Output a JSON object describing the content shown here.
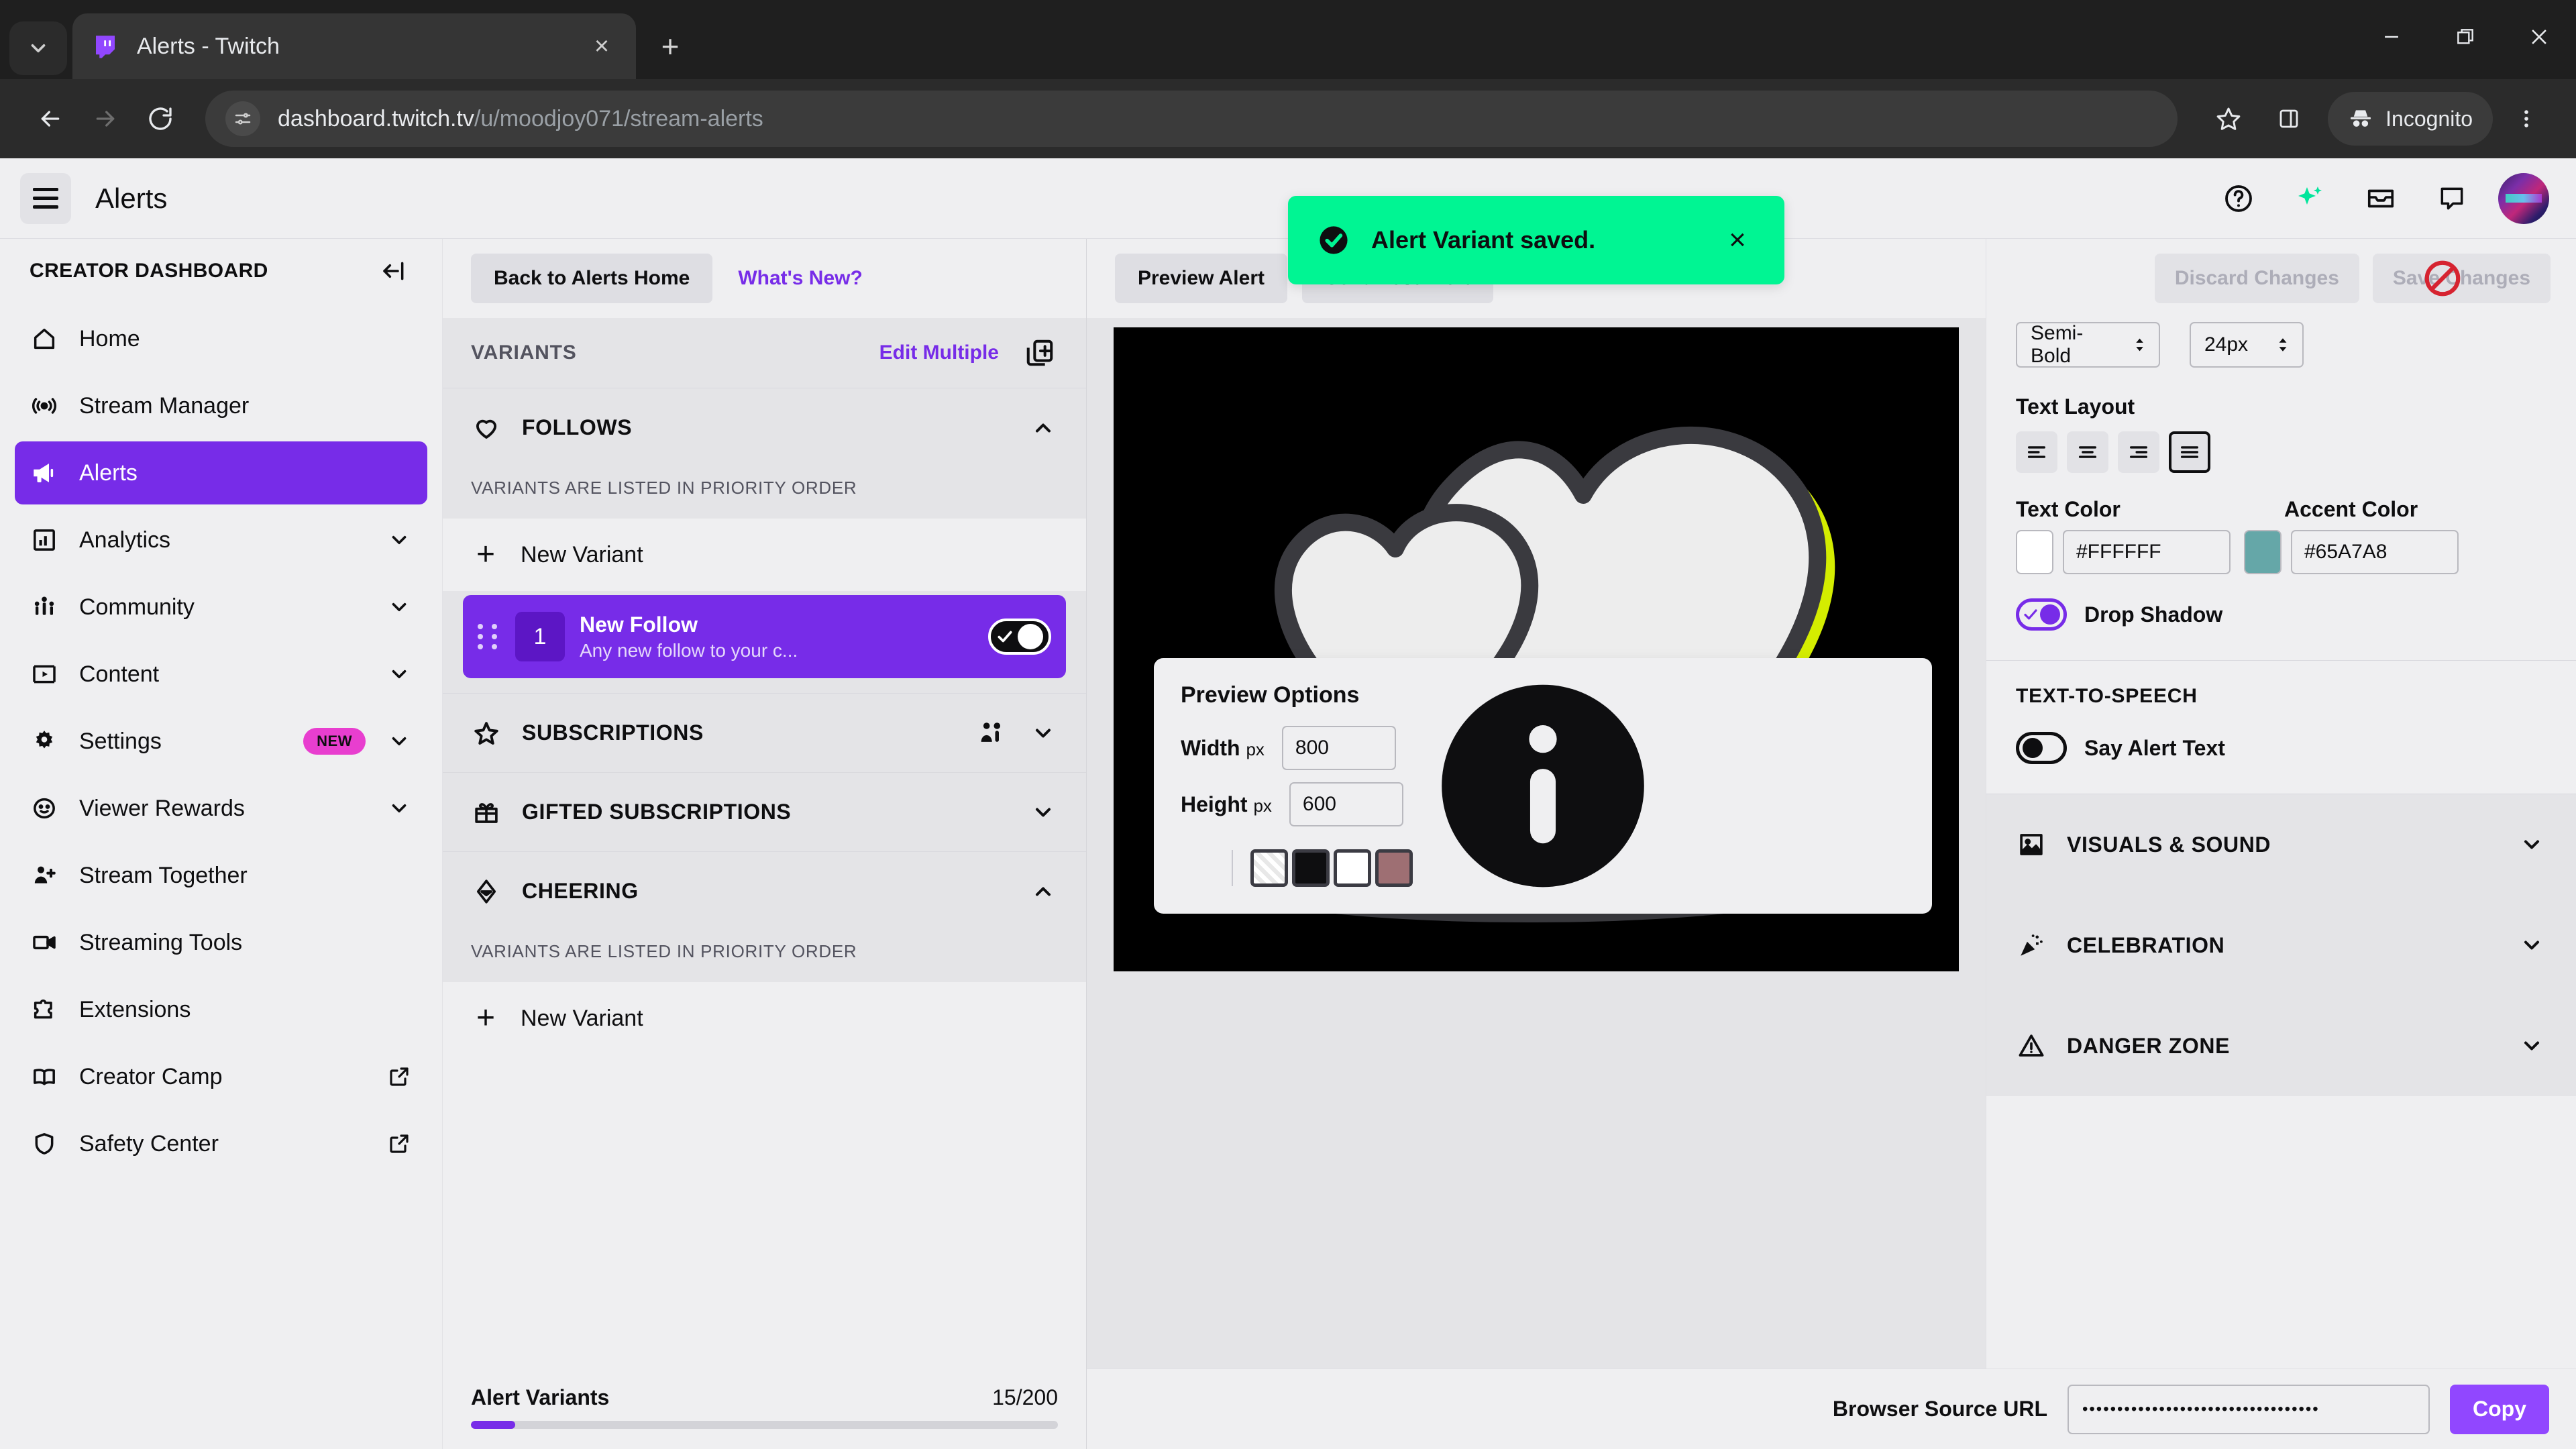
{
  "browser": {
    "tab": {
      "title": "Alerts - Twitch",
      "favicon": "twitch-icon",
      "close": "×"
    },
    "newtab_label": "+",
    "window_controls": {
      "minimize": "minimize-icon",
      "maximize": "maximize-icon",
      "close": "close-icon"
    },
    "url_prefix": "dashboard.twitch.tv",
    "url_suffix": "/u/moodjoy071/stream-alerts",
    "profile_label": "Incognito"
  },
  "app_header": {
    "title": "Alerts"
  },
  "sidebar": {
    "heading": "CREATOR DASHBOARD",
    "items": [
      {
        "label": "Home",
        "icon": "home-icon",
        "active": false
      },
      {
        "label": "Stream Manager",
        "icon": "broadcast-icon",
        "active": false
      },
      {
        "label": "Alerts",
        "icon": "megaphone-icon",
        "active": true
      },
      {
        "label": "Analytics",
        "icon": "bar-chart-icon",
        "active": false,
        "chevron": "chevron-down-icon"
      },
      {
        "label": "Community",
        "icon": "people-icon",
        "active": false,
        "chevron": "chevron-down-icon"
      },
      {
        "label": "Content",
        "icon": "video-frame-icon",
        "active": false,
        "chevron": "chevron-down-icon"
      },
      {
        "label": "Settings",
        "icon": "gear-icon",
        "active": false,
        "badge": "NEW",
        "chevron": "chevron-down-icon"
      },
      {
        "label": "Viewer Rewards",
        "icon": "smiley-icon",
        "active": false,
        "chevron": "chevron-down-icon"
      },
      {
        "label": "Stream Together",
        "icon": "person-add-icon",
        "active": false
      },
      {
        "label": "Streaming Tools",
        "icon": "camcorder-icon",
        "active": false
      },
      {
        "label": "Extensions",
        "icon": "puzzle-icon",
        "active": false
      },
      {
        "label": "Creator Camp",
        "icon": "book-icon",
        "active": false,
        "external": "external-link-icon"
      },
      {
        "label": "Safety Center",
        "icon": "shield-icon",
        "active": false,
        "external": "external-link-icon"
      }
    ]
  },
  "variants_panel": {
    "back_button": "Back to Alerts Home",
    "whats_new": "What's New?",
    "header_title": "VARIANTS",
    "edit_multiple": "Edit Multiple",
    "duplicate_icon": "duplicate-add-icon",
    "priority_note": "VARIANTS ARE LISTED IN PRIORITY ORDER",
    "new_variant": "New Variant",
    "categories": [
      {
        "label": "FOLLOWS",
        "icon": "heart-icon",
        "expanded": true,
        "chevron": "chevron-up-icon"
      },
      {
        "label": "SUBSCRIPTIONS",
        "icon": "star-icon",
        "expanded": false,
        "chevron": "chevron-down-icon",
        "extra_icon": "resub-people-icon"
      },
      {
        "label": "GIFTED SUBSCRIPTIONS",
        "icon": "gift-icon",
        "expanded": false,
        "chevron": "chevron-down-icon"
      },
      {
        "label": "CHEERING",
        "icon": "bits-diamond-icon",
        "expanded": true,
        "chevron": "chevron-up-icon"
      }
    ],
    "follow_variant": {
      "number": "1",
      "name": "New Follow",
      "description": "Any new follow to your c...",
      "enabled": true,
      "drag_handle": "drag-handle-icon"
    },
    "footer": {
      "label": "Alert Variants",
      "count": "15/200",
      "progress_percent": 7.5
    }
  },
  "center": {
    "preview_alert_button": "Preview Alert",
    "send_test_button": "Send Test Alert",
    "toast": {
      "message": "Alert Variant saved.",
      "icon": "check-circle-icon",
      "close": "×",
      "color": "#00F593"
    },
    "preview_options": {
      "title": "Preview Options",
      "width_label": "Width",
      "height_label": "Height",
      "unit": "px",
      "width_value": "800",
      "height_value": "600",
      "info_icon": "info-icon",
      "swatches": [
        "#f5f5f5",
        "#0e0e10",
        "#ffffff",
        "#9e6f73"
      ]
    }
  },
  "right_panel": {
    "discard_button": "Discard Changes",
    "save_button": "Save Changes",
    "save_disabled": true,
    "cursor_icon": "not-allowed-cursor",
    "font_weight_value": "Semi-Bold",
    "font_size_value": "24px",
    "text_layout_label": "Text Layout",
    "align_options": [
      "align-left-icon",
      "align-center-icon",
      "align-right-icon",
      "align-justify-icon"
    ],
    "align_selected_index": 3,
    "text_color_label": "Text Color",
    "text_color_value": "#FFFFFF",
    "accent_color_label": "Accent Color",
    "accent_color_value": "#65A7A8",
    "drop_shadow_label": "Drop Shadow",
    "drop_shadow_on": true,
    "tts_heading": "TEXT-TO-SPEECH",
    "say_alert_label": "Say Alert Text",
    "say_alert_on": false,
    "sections": [
      {
        "label": "VISUALS & SOUND",
        "icon": "image-icon",
        "chevron": "chevron-down-icon"
      },
      {
        "label": "CELEBRATION",
        "icon": "confetti-icon",
        "chevron": "chevron-down-icon"
      },
      {
        "label": "DANGER ZONE",
        "icon": "warning-triangle-icon",
        "chevron": "chevron-down-icon"
      }
    ]
  },
  "bottom_bar": {
    "label": "Browser Source URL",
    "masked_value": "••••••••••••••••••••••••••••••••••",
    "copy_button": "Copy"
  },
  "colors": {
    "twitch_purple": "#772CE8",
    "twitch_purple_light": "#9147FF",
    "toast_green": "#00F593",
    "badge_pink": "#E83ECF",
    "accent_teal": "#65A7A8"
  }
}
